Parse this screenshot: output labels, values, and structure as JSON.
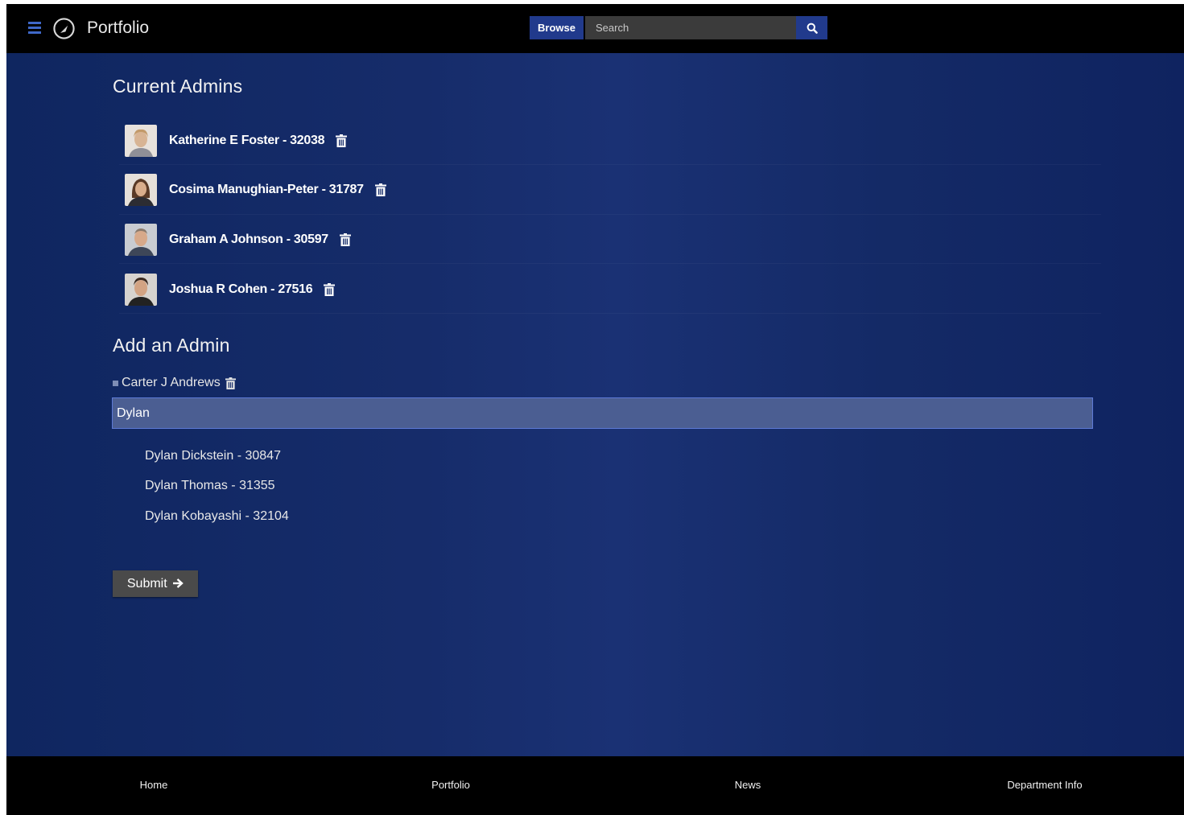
{
  "header": {
    "brand": "Portfolio",
    "browse_label": "Browse",
    "search_placeholder": "Search",
    "accent_color": "#213a8c",
    "menu_icon": "hamburger-icon",
    "logo_icon": "compass-logo-icon",
    "search_icon": "magnifier-icon"
  },
  "current_admins": {
    "title": "Current Admins",
    "items": [
      {
        "label": "Katherine E Foster - 32038"
      },
      {
        "label": "Cosima Manughian-Peter - 31787"
      },
      {
        "label": "Graham A Johnson - 30597"
      },
      {
        "label": "Joshua R Cohen - 27516"
      }
    ],
    "delete_icon": "trash-icon"
  },
  "add_admin": {
    "title": "Add an Admin",
    "selected": "Carter J Andrews",
    "input_value": "Dylan",
    "suggestions": [
      {
        "label": "Dylan Dickstein - 30847"
      },
      {
        "label": "Dylan Thomas - 31355"
      },
      {
        "label": "Dylan Kobayashi - 32104"
      }
    ],
    "submit_label": "Submit",
    "submit_icon": "arrow-right-icon"
  },
  "footer": {
    "links": [
      "Home",
      "Portfolio",
      "News",
      "Department Info"
    ]
  }
}
